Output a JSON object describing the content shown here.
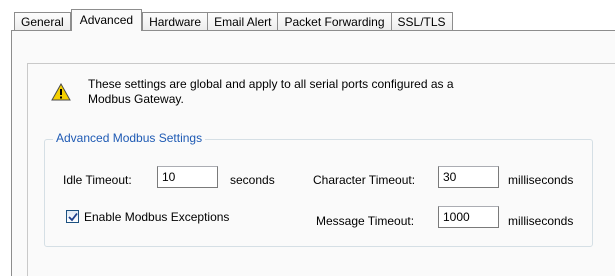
{
  "tabs": [
    {
      "label": "General",
      "active": false
    },
    {
      "label": "Advanced",
      "active": true
    },
    {
      "label": "Hardware",
      "active": false
    },
    {
      "label": "Email Alert",
      "active": false
    },
    {
      "label": "Packet Forwarding",
      "active": false
    },
    {
      "label": "SSL/TLS",
      "active": false
    }
  ],
  "notice": {
    "icon": "warning-icon",
    "line1": "These settings are global and apply to all serial ports configured as a",
    "line2": "Modbus Gateway."
  },
  "group": {
    "title": "Advanced Modbus Settings",
    "idle_timeout": {
      "label": "Idle Timeout:",
      "value": "10",
      "unit": "seconds"
    },
    "character_timeout": {
      "label": "Character Timeout:",
      "value": "30",
      "unit": "milliseconds"
    },
    "message_timeout": {
      "label": "Message Timeout:",
      "value": "1000",
      "unit": "milliseconds"
    },
    "enable_exceptions": {
      "label": "Enable Modbus Exceptions",
      "checked": true
    }
  },
  "colors": {
    "group_title": "#1e5ab4",
    "warning_fill": "#f5d000",
    "checkmark": "#1c3f8c"
  }
}
